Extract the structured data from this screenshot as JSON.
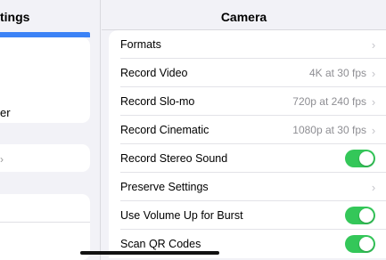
{
  "sidebar": {
    "title": "tings",
    "text_fragment": "er",
    "chevron": "›",
    "selected_color": "#3b82f6"
  },
  "header": {
    "title": "Camera"
  },
  "rows": [
    {
      "label": "Formats",
      "value": "",
      "chevron": "›"
    },
    {
      "label": "Record Video",
      "value": "4K at 30 fps",
      "chevron": "›"
    },
    {
      "label": "Record Slo-mo",
      "value": "720p at 240 fps",
      "chevron": "›"
    },
    {
      "label": "Record Cinematic",
      "value": "1080p at 30 fps",
      "chevron": "›"
    },
    {
      "label": "Record Stereo Sound",
      "toggle": true
    },
    {
      "label": "Preserve Settings",
      "value": "",
      "chevron": "›"
    },
    {
      "label": "Use Volume Up for Burst",
      "toggle": true
    },
    {
      "label": "Scan QR Codes",
      "toggle": true
    }
  ],
  "colors": {
    "toggle_on": "#34c759",
    "background": "#f2f2f7"
  }
}
